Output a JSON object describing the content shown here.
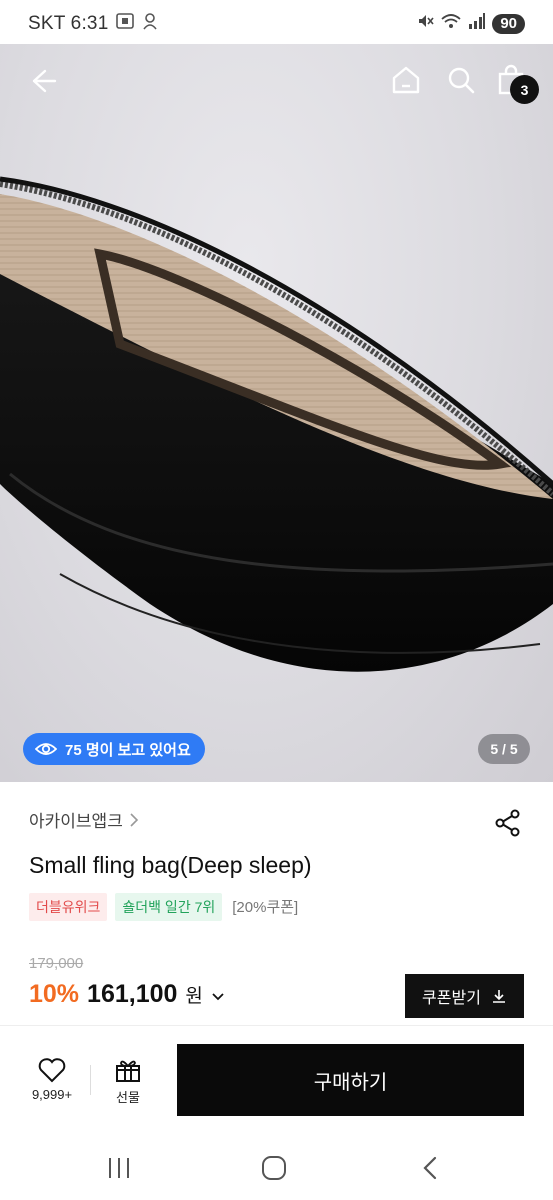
{
  "status_bar": {
    "carrier_time": "SKT 6:31",
    "battery": "90",
    "icons": [
      "screenshot-icon",
      "app-icon",
      "mute-icon",
      "wifi-icon",
      "signal-icon"
    ]
  },
  "top_nav": {
    "icons": [
      "back-arrow-icon",
      "home-icon",
      "search-icon",
      "shopping-bag-icon"
    ],
    "cart_count": "3"
  },
  "image": {
    "viewers_text": "75 명이 보고 있어요",
    "page_indicator": "5 / 5"
  },
  "product": {
    "brand": "아카이브앱크",
    "title": "Small fling bag(Deep sleep)",
    "tags": [
      "더블유위크",
      "숄더백 일간 7위",
      "[20%쿠폰]"
    ],
    "original_price": "179,000",
    "discount": "10%",
    "price": "161,100",
    "currency": "원",
    "coupon_button": "쿠폰받기"
  },
  "bottom_bar": {
    "like_count": "9,999+",
    "gift_label": "선물",
    "buy_label": "구매하기"
  },
  "colors": {
    "accent_blue": "#2f7bf5",
    "discount_orange": "#f26b21",
    "tag_red": "#e24b4b",
    "tag_green": "#22a35b"
  }
}
